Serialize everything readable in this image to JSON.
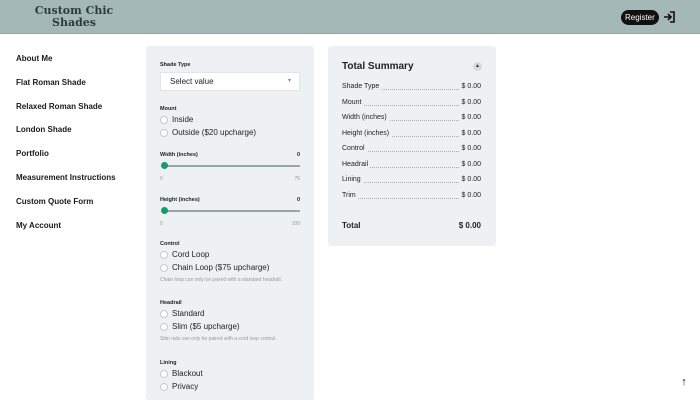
{
  "header": {
    "logo_line1": "Custom Chic",
    "logo_line2": "Shades",
    "register_label": "Register",
    "login_icon": "login-arrow-icon"
  },
  "sidebar": {
    "items": [
      {
        "label": "About Me"
      },
      {
        "label": "Flat Roman Shade"
      },
      {
        "label": "Relaxed Roman Shade"
      },
      {
        "label": "London Shade"
      },
      {
        "label": "Portfolio"
      },
      {
        "label": "Measurement Instructions"
      },
      {
        "label": "Custom Quote Form"
      },
      {
        "label": "My Account"
      }
    ]
  },
  "form": {
    "shade_type": {
      "label": "Shade Type",
      "value": "Select value"
    },
    "mount": {
      "label": "Mount",
      "options": [
        "Inside",
        "Outside ($20 upcharge)"
      ]
    },
    "width": {
      "label": "Width (inches)",
      "value": "0",
      "min": "0",
      "max": "75",
      "fraction": 0
    },
    "height": {
      "label": "Height (inches)",
      "value": "0",
      "min": "0",
      "max": "100",
      "fraction": 0
    },
    "control": {
      "label": "Control",
      "options": [
        "Cord Loop",
        "Chain Loop ($75 upcharge)"
      ],
      "helper": "Chain loop can only be paired with a standard headrail."
    },
    "headrail": {
      "label": "Headrail",
      "options": [
        "Standard",
        "Slim ($5 upcharge)"
      ],
      "helper": "Slim rails can only be paired with a cord loop control."
    },
    "lining": {
      "label": "Lining",
      "options": [
        "Blackout",
        "Privacy"
      ]
    }
  },
  "summary": {
    "title": "Total Summary",
    "collapse_icon": "chevron-up-icon",
    "rows": [
      {
        "label": "Shade Type",
        "value": "$ 0.00"
      },
      {
        "label": "Mount",
        "value": "$ 0.00"
      },
      {
        "label": "Width (inches)",
        "value": "$ 0.00"
      },
      {
        "label": "Height (inches)",
        "value": "$ 0.00"
      },
      {
        "label": "Control",
        "value": "$ 0.00"
      },
      {
        "label": "Headrail",
        "value": "$ 0.00"
      },
      {
        "label": "Lining",
        "value": "$ 0.00"
      },
      {
        "label": "Trim",
        "value": "$ 0.00"
      }
    ],
    "total_label": "Total",
    "total_value": "$ 0.00"
  },
  "scroll_top_icon": "arrow-up-icon",
  "colors": {
    "header_bg": "#a4b8b8",
    "panel_bg": "#eef1f1",
    "slider_thumb": "#1a9a6a",
    "button_bg": "#111111"
  }
}
